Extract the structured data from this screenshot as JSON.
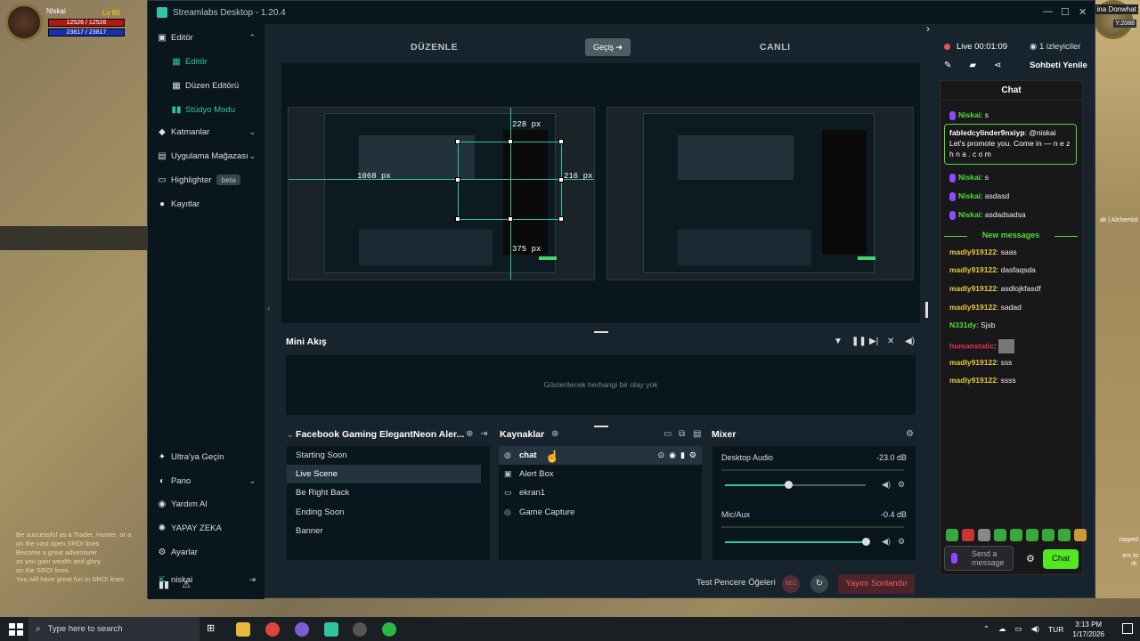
{
  "game": {
    "player_name": "Niskai",
    "level": "Lv 80",
    "hp": "12526 / 12526",
    "mp": "23817 / 23817",
    "right_label": "ina Donwhat",
    "right_year": "Y:2088",
    "right_text_1": "ak | Alchemist",
    "right_text_2": "ropped",
    "right_text_3": "em to",
    "right_text_4": "rk.",
    "left_lines": [
      "Be successful as a Trader, Hunter, or a",
      "on the vast open SRO! lines",
      "Become a great adventurer",
      "as you gain wealth and glory",
      "on the SRO! lines",
      "You will have great fun in SRO! lines"
    ]
  },
  "window": {
    "title": "Streamlabs Desktop - 1.20.4"
  },
  "sidebar": {
    "editor": "Editör",
    "editor_sub": "Editör",
    "layout_editor": "Düzen Editörü",
    "studio_mode": "Stüdyo Modu",
    "layers": "Katmanlar",
    "app_store": "Uygulama Mağazası",
    "highlighter": "Highlighter",
    "beta": "beta",
    "recordings": "Kayıtlar",
    "ultra": "Ultra'ya Geçin",
    "dashboard": "Pano",
    "help": "Yardım Al",
    "ai": "YAPAY ZEKA",
    "settings": "Ayarlar",
    "user": "niskai"
  },
  "header": {
    "edit": "DÜZENLE",
    "transition": "Geçiş",
    "live": "CANLI"
  },
  "preview": {
    "px_top": "228 px",
    "px_left": "1068 px",
    "px_right": "216 px",
    "px_bottom": "375 px"
  },
  "mini_feed": {
    "title": "Mini Akış",
    "empty": "Gösterilecek herhangi bir olay yok"
  },
  "scenes": {
    "title": "Facebook Gaming ElegantNeon Aler...",
    "items": [
      "Starting Soon",
      "Live Scene",
      "Be Right Back",
      "Ending Soon",
      "Banner"
    ]
  },
  "sources": {
    "title": "Kaynaklar",
    "items": [
      "chat",
      "Alert Box",
      "ekran1",
      "Game Capture"
    ]
  },
  "mixer": {
    "title": "Mixer",
    "channels": [
      {
        "name": "Desktop Audio",
        "db": "-23.0 dB",
        "level": 0.45
      },
      {
        "name": "Mic/Aux",
        "db": "-0.4 dB",
        "level": 1.0
      }
    ]
  },
  "footer": {
    "test_widgets": "Test Pencere Öğeleri",
    "rec": "REC",
    "end_stream": "Yayını Sonlandır"
  },
  "stream": {
    "live_time": "Live 00:01:09",
    "viewers": "1 izleyiciler",
    "refresh_chat": "Sohbeti Yenile"
  },
  "chat": {
    "title": "Chat",
    "messages": [
      {
        "user": "Niskai",
        "text": "s"
      },
      {
        "user": "Niskai",
        "text": "s"
      },
      {
        "user": "Niskai",
        "text": "asdasd"
      },
      {
        "user": "Niskai",
        "text": "asdadsadsa"
      }
    ],
    "highlight_user": "fabledcylinder9nxiyp",
    "highlight_text": "@niskai Let's promote you. Come in — n e z h n a . c o m",
    "new_messages": "New messages",
    "new": [
      {
        "user": "madly919122",
        "text": "saas"
      },
      {
        "user": "madly919122",
        "text": "dasfaqsda"
      },
      {
        "user": "madly919122",
        "text": "asdlojkfasdf"
      },
      {
        "user": "madly919122",
        "text": "sadad"
      },
      {
        "user": "N331dy",
        "text": "Sjsb"
      },
      {
        "user": "humanstatic",
        "text": ""
      },
      {
        "user": "madly919122",
        "text": "sss"
      },
      {
        "user": "madly919122",
        "text": "ssss"
      }
    ],
    "input_placeholder": "Send a message",
    "send": "Chat"
  },
  "taskbar": {
    "search": "Type here to search",
    "lang": "TUR",
    "time": "3:13 PM",
    "date": "1/17/2026"
  },
  "colors": {
    "accent": "#31c3a2",
    "chat_green": "#52dc3b",
    "end_red": "#f45d6b"
  }
}
